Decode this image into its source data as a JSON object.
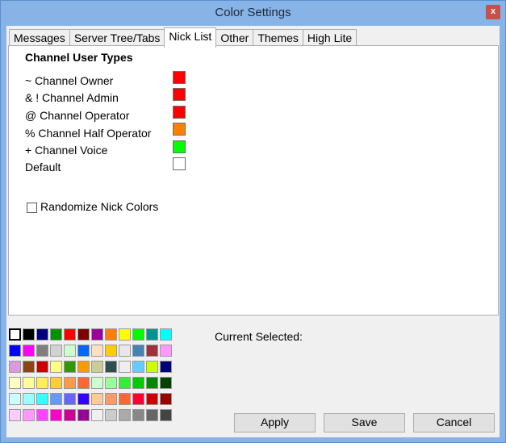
{
  "window": {
    "title": "Color Settings",
    "close_glyph": "x"
  },
  "tabs": [
    {
      "label": "Messages",
      "active": false
    },
    {
      "label": "Server Tree/Tabs",
      "active": false
    },
    {
      "label": "Nick List",
      "active": true
    },
    {
      "label": "Other",
      "active": false
    },
    {
      "label": "Themes",
      "active": false
    },
    {
      "label": "High Lite",
      "active": false
    }
  ],
  "nicklist": {
    "section_title": "Channel User Types",
    "types": [
      {
        "label": "~  Channel Owner",
        "color": "#ff0000"
      },
      {
        "label": "& !  Channel Admin",
        "color": "#ff0000"
      },
      {
        "label": "@ Channel Operator",
        "color": "#ff0000"
      },
      {
        "label": "% Channel Half Operator",
        "color": "#ff8000"
      },
      {
        "label": "+ Channel Voice",
        "color": "#00ff00"
      },
      {
        "label": "Default",
        "color": "#ffffff"
      }
    ],
    "randomize_label": "Randomize Nick Colors",
    "randomize_checked": false
  },
  "palette": {
    "selected_index": 0,
    "rows": [
      [
        "#ffffff",
        "#000000",
        "#00007f",
        "#009300",
        "#ff0000",
        "#7f0000",
        "#9c009c",
        "#fc7f00",
        "#ffff00",
        "#00fc00",
        "#009393",
        "#00ffff"
      ],
      [
        "#0000fc",
        "#ff00ff",
        "#7f7f7f",
        "#d2d2d2",
        "#ccffcc",
        "#0066ff",
        "#ffe0c0",
        "#ffcc00",
        "#e8e8e8",
        "#4682b4",
        "#a0303a",
        "#ff99ff"
      ],
      [
        "#dd99dd",
        "#8b4513",
        "#cc0000",
        "#ffff80",
        "#339900",
        "#ff9900",
        "#cccc99",
        "#2f4f4f",
        "#eeeeee",
        "#66ccff",
        "#ccff00",
        "#000080"
      ],
      [
        "#ffffc0",
        "#ffff99",
        "#ffee55",
        "#ffcc33",
        "#ff9944",
        "#ff6633",
        "#ccffcc",
        "#99ff99",
        "#33ee33",
        "#00cc00",
        "#008800",
        "#004400"
      ],
      [
        "#ccffff",
        "#99ffff",
        "#33ffff",
        "#6699ff",
        "#6666ff",
        "#3300ff",
        "#ffcc99",
        "#ff9966",
        "#ff6633",
        "#ff0033",
        "#cc0000",
        "#990000"
      ],
      [
        "#ffccff",
        "#ff99ff",
        "#ff44ff",
        "#ff00cc",
        "#cc0099",
        "#990099",
        "#f0f0f0",
        "#cccccc",
        "#aaaaaa",
        "#888888",
        "#666666",
        "#444444"
      ]
    ]
  },
  "current_selected_label": "Current Selected:",
  "buttons": {
    "apply": "Apply",
    "save": "Save",
    "cancel": "Cancel"
  }
}
